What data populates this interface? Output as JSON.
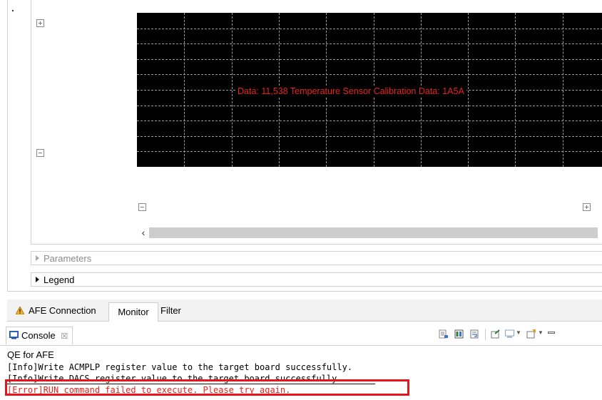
{
  "monitor": {
    "plot_label": "Data: 11,538  Temperature Sensor Calibration Data: 1A5A",
    "plot_bg": "#000000",
    "label_color": "#e8221c",
    "controls": [
      "expand-icon",
      "collapse-icon",
      "collapse-icon",
      "expand-icon"
    ],
    "scroll_left": "‹",
    "scroll_right": "›"
  },
  "sections": {
    "parameters": "Parameters",
    "legend": "Legend"
  },
  "tabs": {
    "afe_connection": "AFE Connection",
    "monitor": "Monitor",
    "filter": "Filter"
  },
  "console": {
    "tab_label": "Console",
    "close_glyph": "☒",
    "title": "QE for AFE",
    "lines": [
      "[Info]Write ACMPLP register value to the target board successfully.",
      "[Info]Write DACS register value to the target board successfully.",
      "[Error]RUN command failed to execute. Please try again."
    ],
    "error_color": "#e8221c"
  }
}
